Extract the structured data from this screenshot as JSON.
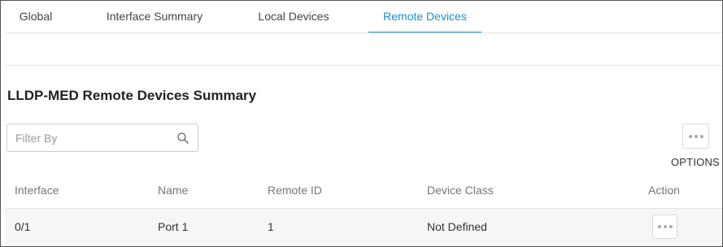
{
  "tabs": [
    {
      "label": "Global",
      "active": false
    },
    {
      "label": "Interface Summary",
      "active": false
    },
    {
      "label": "Local Devices",
      "active": false
    },
    {
      "label": "Remote Devices",
      "active": true
    }
  ],
  "page_title": "LLDP-MED Remote Devices Summary",
  "filter": {
    "placeholder": "Filter By",
    "value": "",
    "icon": "search-icon"
  },
  "options": {
    "label": "OPTIONS",
    "icon": "more-dots-icon"
  },
  "table": {
    "columns": [
      "Interface",
      "Name",
      "Remote ID",
      "Device Class",
      "Action"
    ],
    "rows": [
      {
        "interface": "0/1",
        "name": "Port 1",
        "remote_id": "1",
        "device_class": "Not Defined"
      }
    ]
  },
  "colors": {
    "accent": "#1a8ed8",
    "row_bg": "#f6f6f6",
    "border": "#e3e3e3"
  }
}
